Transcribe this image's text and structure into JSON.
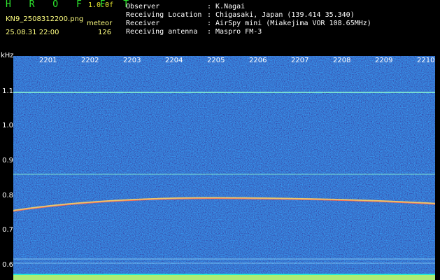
{
  "header": {
    "title": "H R O F F T",
    "version": "1.0.0f",
    "file_name": "KN9_2508312200.png",
    "meteor_label": "meteor",
    "date_time": "25.08.31 22:00",
    "meteor_count": "126",
    "info": [
      {
        "label": "Observer",
        "value": ": K.Nagai"
      },
      {
        "label": "Receiving Location",
        "value": ": Chigasaki, Japan (139.414 35.340)"
      },
      {
        "label": "Receiver",
        "value": ": AirSpy mini (Miakejima VOR 108.65MHz)"
      },
      {
        "label": "Receiving antenna",
        "value": ": Maspro FM-3"
      }
    ]
  },
  "plot": {
    "y_unit": "kHz",
    "x_ticks": [
      "2201",
      "2202",
      "2203",
      "2204",
      "2205",
      "2206",
      "2207",
      "2208",
      "2209",
      "2210"
    ],
    "y_ticks": [
      "1.1",
      "1.0",
      "0.9",
      "0.8",
      "0.7",
      "0.6"
    ],
    "colors": {
      "background": "#0a1a9a",
      "line": "#6fe6ff"
    }
  }
}
